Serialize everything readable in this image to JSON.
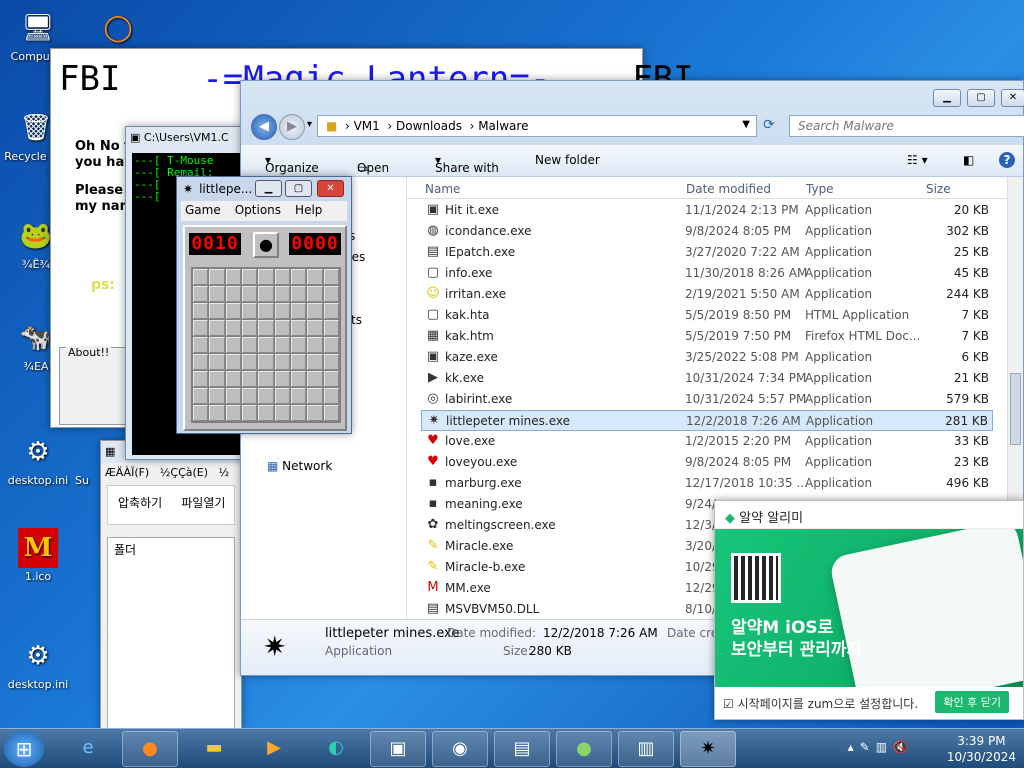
{
  "desktop": {
    "icons": [
      {
        "label": "Computer",
        "glyph": "🖥"
      },
      {
        "label": "Recycle Bin",
        "glyph": "🗑"
      },
      {
        "label": "¾Ë¾",
        "glyph": "🐸"
      },
      {
        "label": "¾EA",
        "glyph": "🐄"
      },
      {
        "label": "desktop.ini",
        "glyph": "⚙"
      },
      {
        "label": "1.ico",
        "glyph": "M"
      },
      {
        "label": "desktop.ini",
        "glyph": "⚙"
      },
      {
        "label": "Su",
        "glyph": "▫"
      }
    ]
  },
  "fbi_window": {
    "title_left": "FBI",
    "title_mid": "-=Magic Lantern=-",
    "title_right": "FBI",
    "line1": "Oh No t",
    "line2": "you hav",
    "line3": "Please",
    "line4": "my nam",
    "yellow": "ps:",
    "about": "About!!"
  },
  "cmd_window": {
    "title": "C:\\Users\\VM1.C",
    "lines": [
      "---[ T-Mouse",
      "---[ Remail:",
      "---[",
      "---["
    ]
  },
  "archiver": {
    "title": "ÆÄÀÏ(F)",
    "menu": [
      "ÆÄÀÏ(F)",
      "½ÇÇà(E)",
      "½"
    ],
    "tool1": "압축하기",
    "tool2": "파일열기",
    "folder": "폴더"
  },
  "minesweeper": {
    "title": "littlepe...",
    "menu": [
      "Game",
      "Options",
      "Help"
    ],
    "mines_left": "0010",
    "timer": "0000"
  },
  "explorer": {
    "breadcrumb": [
      "VM1",
      "Downloads",
      "Malware"
    ],
    "search_placeholder": "Search Malware",
    "toolbar": {
      "organize": "Organize",
      "open": "Open",
      "share": "Share with",
      "newfolder": "New folder"
    },
    "nav": {
      "network": "Network",
      "frag1": "s",
      "frag2": "ces",
      "frag3": "ts"
    },
    "columns": {
      "name": "Name",
      "date": "Date modified",
      "type": "Type",
      "size": "Size"
    },
    "files": [
      {
        "name": "Hit it.exe",
        "date": "11/1/2024 2:13 PM",
        "type": "Application",
        "size": "20 KB",
        "icon": "▣"
      },
      {
        "name": "icondance.exe",
        "date": "9/8/2024 8:05 PM",
        "type": "Application",
        "size": "302 KB",
        "icon": "◍"
      },
      {
        "name": "IEpatch.exe",
        "date": "3/27/2020 7:22 AM",
        "type": "Application",
        "size": "25 KB",
        "icon": "▤"
      },
      {
        "name": "info.exe",
        "date": "11/30/2018 8:26 AM",
        "type": "Application",
        "size": "45 KB",
        "icon": "▢"
      },
      {
        "name": "irritan.exe",
        "date": "2/19/2021 5:50 AM",
        "type": "Application",
        "size": "244 KB",
        "icon": "☺"
      },
      {
        "name": "kak.hta",
        "date": "5/5/2019 8:50 PM",
        "type": "HTML Application",
        "size": "7 KB",
        "icon": "▢"
      },
      {
        "name": "kak.htm",
        "date": "5/5/2019 7:50 PM",
        "type": "Firefox HTML Doc...",
        "size": "7 KB",
        "icon": "▦"
      },
      {
        "name": "kaze.exe",
        "date": "3/25/2022 5:08 PM",
        "type": "Application",
        "size": "6 KB",
        "icon": "▣"
      },
      {
        "name": "kk.exe",
        "date": "10/31/2024 7:34 PM",
        "type": "Application",
        "size": "21 KB",
        "icon": "▶"
      },
      {
        "name": "labirint.exe",
        "date": "10/31/2024 5:57 PM",
        "type": "Application",
        "size": "579 KB",
        "icon": "◎"
      },
      {
        "name": "littlepeter mines.exe",
        "date": "12/2/2018 7:26 AM",
        "type": "Application",
        "size": "281 KB",
        "icon": "✷"
      },
      {
        "name": "love.exe",
        "date": "1/2/2015 2:20 PM",
        "type": "Application",
        "size": "33 KB",
        "icon": "♥"
      },
      {
        "name": "loveyou.exe",
        "date": "9/8/2024 8:05 PM",
        "type": "Application",
        "size": "23 KB",
        "icon": "♥"
      },
      {
        "name": "marburg.exe",
        "date": "12/17/2018 10:35 ...",
        "type": "Application",
        "size": "496 KB",
        "icon": "▪"
      },
      {
        "name": "meaning.exe",
        "date": "9/24/",
        "type": "",
        "size": "",
        "icon": "▪"
      },
      {
        "name": "meltingscreen.exe",
        "date": "12/3/",
        "type": "",
        "size": "",
        "icon": "✿"
      },
      {
        "name": "Miracle.exe",
        "date": "3/20/",
        "type": "",
        "size": "",
        "icon": "✎"
      },
      {
        "name": "Miracle-b.exe",
        "date": "10/29",
        "type": "",
        "size": "",
        "icon": "✎"
      },
      {
        "name": "MM.exe",
        "date": "12/29",
        "type": "",
        "size": "",
        "icon": "M"
      },
      {
        "name": "MSVBVM50.DLL",
        "date": "8/10/",
        "type": "",
        "size": "",
        "icon": "▤"
      }
    ],
    "details": {
      "name": "littlepeter mines.exe",
      "kind": "Application",
      "modified_label": "Date modified:",
      "modified": "12/2/2018 7:26 AM",
      "size_label": "Size:",
      "size": "280 KB",
      "created_label": "Date crea"
    }
  },
  "popup": {
    "title": "알약 알리미",
    "headline1": "알약M iOS로",
    "headline2": "보안부터 관리까지",
    "checkbox_label": "시작페이지를 zum으로 설정합니다.",
    "confirm": "확인 후 닫기"
  },
  "taskbar": {
    "time": "3:39 PM",
    "date": "10/30/2024"
  }
}
